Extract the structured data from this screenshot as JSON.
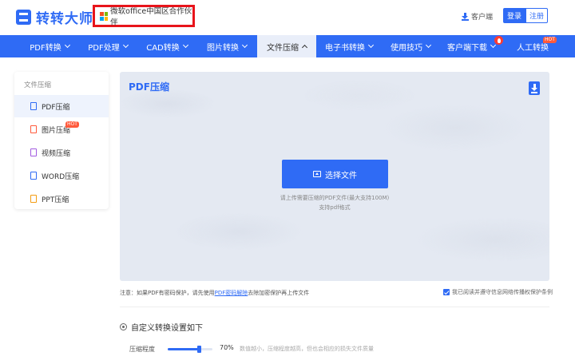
{
  "header": {
    "brand": "转转大师",
    "partner_text": "微软office中国区合作伙伴",
    "client_link": "客户端",
    "login_label": "登录",
    "register_label": "注册"
  },
  "nav": {
    "items": [
      {
        "label": "PDF转换"
      },
      {
        "label": "PDF处理"
      },
      {
        "label": "CAD转换"
      },
      {
        "label": "图片转换"
      },
      {
        "label": "文件压缩"
      },
      {
        "label": "电子书转换"
      },
      {
        "label": "使用技巧"
      },
      {
        "label": "客户端下载"
      },
      {
        "label": "人工转换"
      }
    ],
    "hot_badge": "HOT"
  },
  "sidebar": {
    "title": "文件压缩",
    "items": [
      {
        "label": "PDF压缩"
      },
      {
        "label": "图片压缩"
      },
      {
        "label": "视频压缩"
      },
      {
        "label": "WORD压缩"
      },
      {
        "label": "PPT压缩"
      }
    ],
    "hot_badge": "HOT"
  },
  "main": {
    "title": "PDF压缩",
    "choose_button": "选择文件",
    "hint_line1": "请上传需要压缩的PDF文件(最大支持100M)",
    "hint_line2": "支持pdf格式"
  },
  "notice": {
    "prefix": "注意：如果PDF有密码保护，请先使用",
    "link": "PDF密码解除",
    "suffix": "去除加密保护再上传文件",
    "agree_text": "我已阅读并遵守信息网络传播权保护条例"
  },
  "settings": {
    "heading": "自定义转换设置如下",
    "level_label": "压缩程度",
    "level_value": "70%",
    "level_fraction": 0.7,
    "level_desc": "数值越小，压缩程度越高，但也会相应的损失文件质量"
  },
  "colors": {
    "accent": "#2f6bf5",
    "highlight_box": "#e8141b",
    "hot": "#ff5a3c"
  }
}
